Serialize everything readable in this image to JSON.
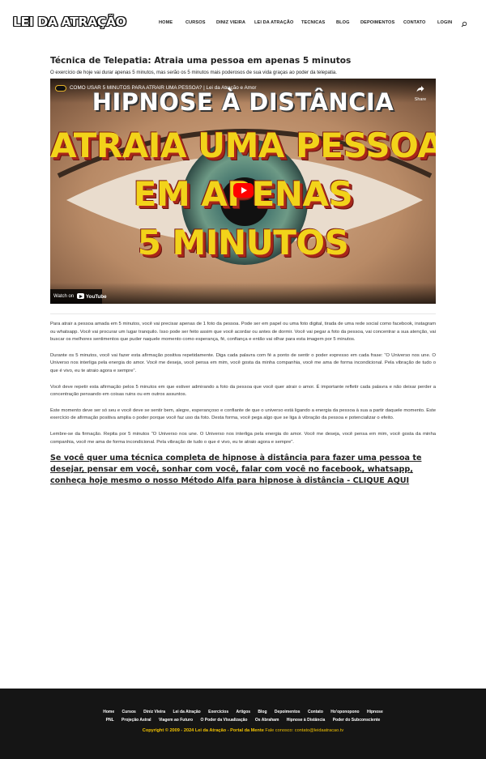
{
  "header": {
    "logo": "LEI DA ATRAÇÃO",
    "nav": [
      "HOME",
      "CURSOS",
      "DINIZ VIEIRA",
      "LEI DA ATRAÇÃO",
      "TECNICAS",
      "BLOG",
      "DEPOIMENTOS",
      "CONTATO",
      "LOGIN"
    ],
    "search_icon": "search-icon"
  },
  "main": {
    "title": "Técnica de Telepatia: Atraia uma pessoa em apenas 5 minutos",
    "subtitle": "O exercício de hoje vai durar apenas 5 minutos, mas serão os 5 minutos mais poderosos de sua vida graças ao poder da telepatia.",
    "video": {
      "title": "COMO USAR 5 MINUTOS PARA ATRAIR UMA PESSOA? | Lei da Atração e Amor",
      "share_label": "Share",
      "thumbnail_lines": [
        "HIPNOSE À DISTÂNCIA",
        "ATRAIA UMA PESSOA",
        "EM APENAS",
        "5 MINUTOS"
      ],
      "watch_on": "Watch on",
      "youtube": "YouTube"
    },
    "paragraphs": [
      "Para atrair a pessoa amada em 5 minutos, você vai precisar apenas de 1 foto da pessoa. Pode ser em papel ou uma foto digital, tirada de uma rede social como facebook, instagram ou whatsapp. Você vai procurar um lugar tranquilo. Isso pode ser feito assim que você acordar ou antes de dormir. Você vai pegar a foto da pessoa, vai concentrar a sua atenção, vai buscar os melhores sentimentos que puder naquele momento como esperança, fé, confiança e então vai olhar para esta imagem por 5 minutos.",
      "Durante os 5 minutos, você vai fazer esta afirmação positiva repetidamente. Diga cada palavra com fé a ponto de sentir o poder expresso em cada frase: “O Universo nos une. O Universo nos interliga pela energia do amor. Você me deseja, você pensa em mim, você gosta da minha companhia, você me ama de forma incondicional. Pela vibração de tudo o que é vivo, eu te atraio agora e sempre”.",
      "Você deve repetir esta afirmação pelos 5 minutos em que estiver admirando a foto da pessoa que você quer atrair o amor. É importante refletir cada palavra e não deixar perder a concentração pensando em coisas ruins ou em outros assuntos.",
      "Este momento deve ser só seu e você deve se sentir bem, alegre, esperançoso e confiante de que o universo está ligando a energia da pessoa à sua a partir daquele momento. Este exercício de afirmação positiva amplia o poder porque você faz uso da foto. Desta forma, você pega algo que se liga à vibração da pessoa e potencializar o efeito.",
      "Lembre-se da firmação. Repita por 5 minutos “O Universo nos une. O Universo nos interliga pela energia do amor. Você me deseja, você pensa em mim, você gosta da minha companhia, você me ama de forma incondicional. Pela vibração de tudo o que é vivo, eu te atraio agora e sempre”."
    ],
    "cta": "Se você quer uma técnica completa de hipnose à distância para fazer uma pessoa te desejar, pensar em você, sonhar com você, falar com você no facebook, whatsapp, conheça hoje mesmo o nosso Método Alfa para hipnose à distância - CLIQUE AQUI"
  },
  "footer": {
    "links_row1": [
      "Home",
      "Cursos",
      "Diniz Vieira",
      "Lei da Atração",
      "Exercícios",
      "Artigos",
      "Blog",
      "Depoimentos",
      "Contato",
      "Ho'oponopono",
      "Hipnose"
    ],
    "links_row2": [
      "PNL",
      "Projeção Astral",
      "Viagem ao Futuro",
      "O Poder da Visualização",
      "Os Abraham",
      "Hipnose à Distância",
      "Poder do Subconsciente"
    ],
    "copyright": "Copyright © 2009 - 2024 Lei da Atração - Portal da Mente",
    "contact_label": "Fale conosco:",
    "email": "contato@leidaatracao.tv",
    "colors": {
      "background": "#151515",
      "accent": "#f2c200"
    }
  }
}
